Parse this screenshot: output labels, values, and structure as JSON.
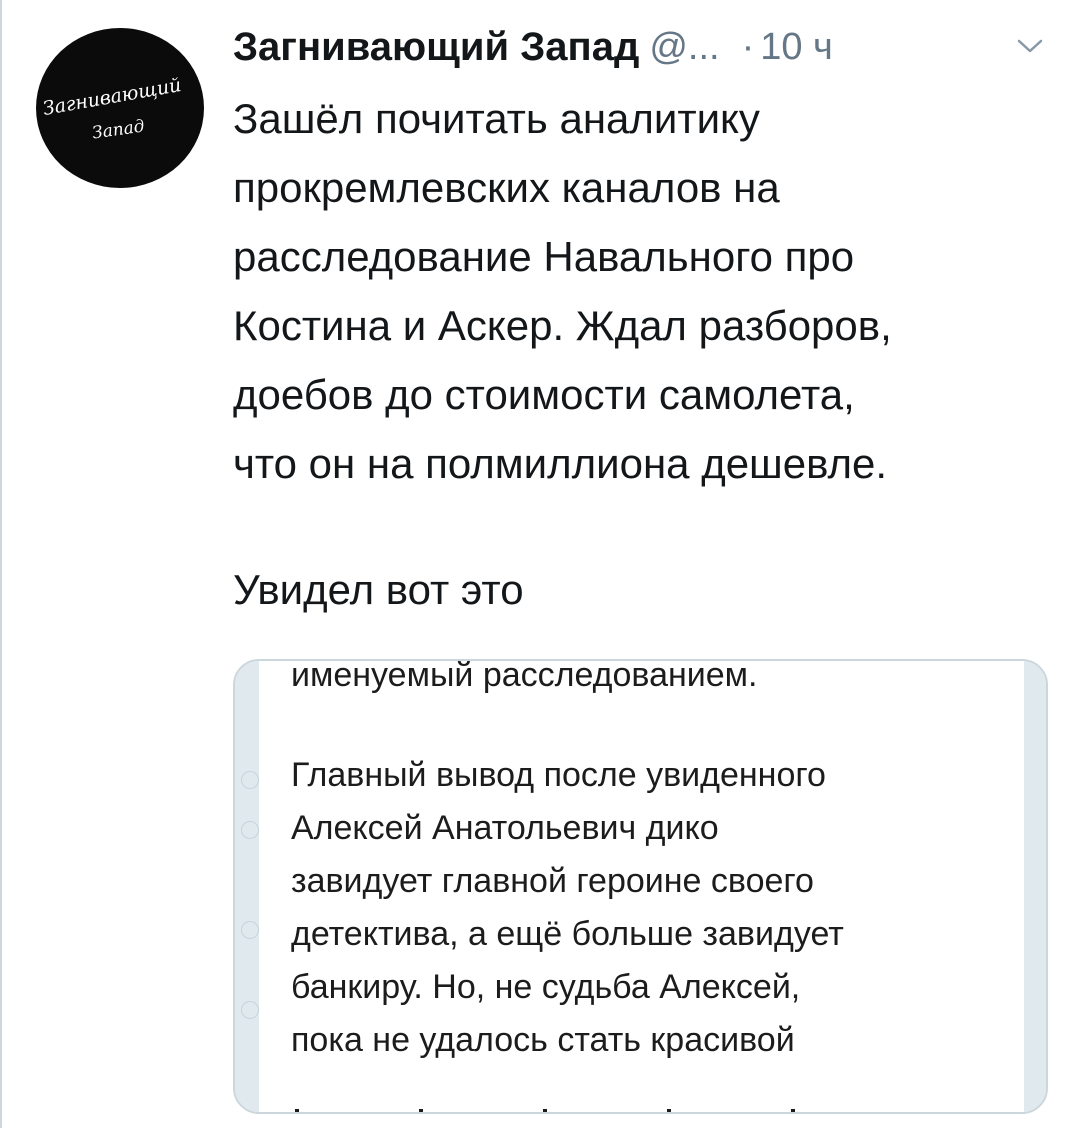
{
  "avatar": {
    "line1": "Загнивающий",
    "line2": "Запад"
  },
  "header": {
    "display_name": "Загнивающий Запад",
    "handle": "@...",
    "separator": "·",
    "time": "10 ч",
    "menu_icon": "chevron-down-icon"
  },
  "tweet": {
    "lines": [
      "Зашёл почитать аналитику",
      "прокремлевских каналов на",
      "расследование Навального про",
      "Костина и Аскер. Ждал разборов,",
      "доебов до стоимости самолета,",
      "что он на полмиллиона дешевле."
    ],
    "extra": "Увидел вот это"
  },
  "media": {
    "first_line": "именуемый расследованием.",
    "lines": [
      "Главный вывод после увиденного",
      "Алексей Анатольевич дико",
      "завидует главной героине своего",
      "детектива, а ещё больше завидует",
      "банкиру. Но, не судьба Алексей,",
      "пока не удалось стать красивой"
    ]
  },
  "colors": {
    "text": "#14171a",
    "secondary": "#657786",
    "border": "#ccd6dd",
    "media_strip": "#dfe9ee"
  }
}
